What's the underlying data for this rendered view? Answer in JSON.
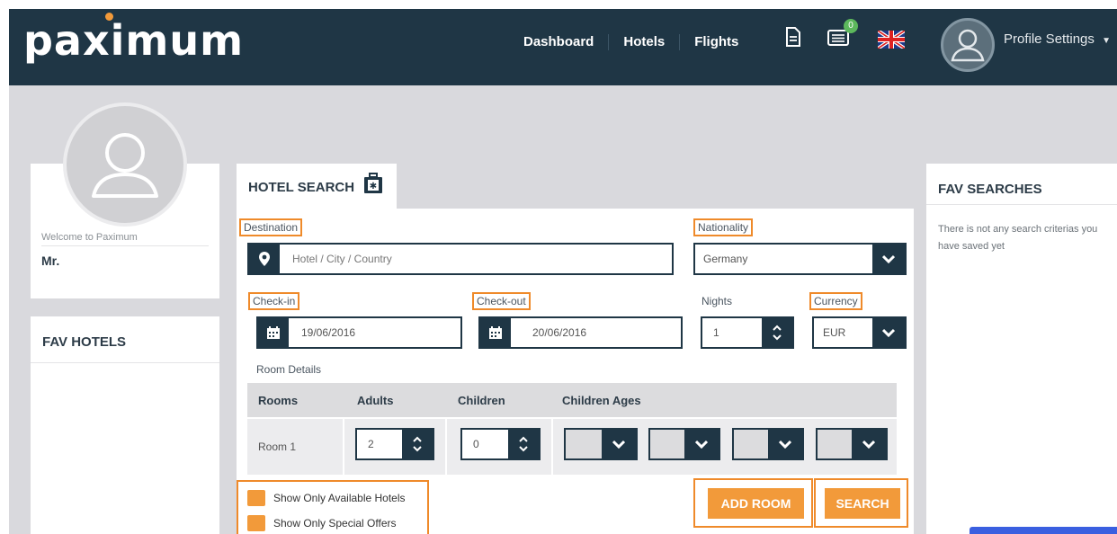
{
  "header": {
    "logo": "paximum",
    "nav": [
      "Dashboard",
      "Hotels",
      "Flights"
    ],
    "notification_count": "0",
    "profile_label": "Profile Settings"
  },
  "sidebar": {
    "welcome_text": "Welcome to Paximum",
    "user_name": "Mr.",
    "fav_hotels_title": "FAV HOTELS"
  },
  "search": {
    "tab_title": "HOTEL SEARCH",
    "destination_label": "Destination",
    "destination_placeholder": "Hotel / City / Country",
    "nationality_label": "Nationality",
    "nationality_value": "Germany",
    "checkin_label": "Check-in",
    "checkin_value": "19/06/2016",
    "checkout_label": "Check-out",
    "checkout_value": "20/06/2016",
    "nights_label": "Nights",
    "nights_value": "1",
    "currency_label": "Currency",
    "currency_value": "EUR",
    "room_details_label": "Room Details",
    "table_headers": [
      "Rooms",
      "Adults",
      "Children",
      "Children Ages"
    ],
    "rooms": [
      {
        "name": "Room 1",
        "adults": "2",
        "children": "0"
      }
    ],
    "checkbox_available": "Show Only Available Hotels",
    "checkbox_special": "Show Only Special Offers",
    "add_room_label": "ADD ROOM",
    "search_label": "SEARCH"
  },
  "fav_searches": {
    "title": "FAV SEARCHES",
    "empty_text": "There is not any search criterias you have saved yet"
  },
  "colors": {
    "nav_bg": "#1f3645",
    "accent": "#f29a3a",
    "highlight": "#ef8a2a",
    "background": "#d9d9dd"
  }
}
